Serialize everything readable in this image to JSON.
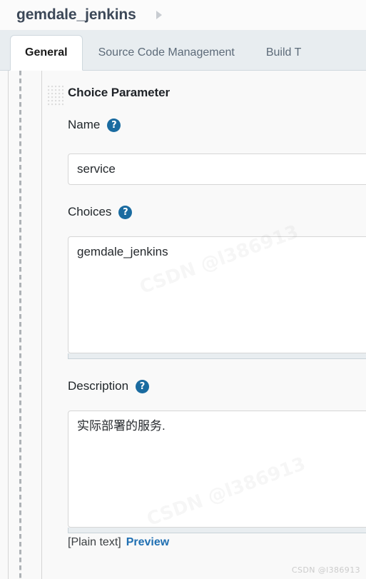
{
  "header": {
    "job_title": "gemdale_jenkins",
    "breadcrumb_caret": "▸"
  },
  "tabs": [
    {
      "label": "General",
      "active": true
    },
    {
      "label": "Source Code Management",
      "active": false
    },
    {
      "label": "Build T",
      "active": false
    }
  ],
  "parameter_block": {
    "section_title": "Choice Parameter",
    "help_glyph": "?",
    "fields": {
      "name": {
        "label": "Name",
        "value": "service",
        "placeholder": ""
      },
      "choices": {
        "label": "Choices",
        "value": "gemdale_jenkins",
        "placeholder": ""
      },
      "description": {
        "label": "Description",
        "value": "实际部署的服务.",
        "placeholder": ""
      }
    },
    "markup_footer": {
      "plain_text_label": "[Plain text]",
      "preview_label": "Preview"
    }
  },
  "watermark": {
    "corner": "CSDN @l386913",
    "diagonal": "CSDN @l386913"
  },
  "colors": {
    "accent_blue": "#1a6ba0",
    "link_blue": "#1f6fb2",
    "tab_strip_bg": "#e8edf0",
    "panel_bg": "#f9f9f9",
    "title_text": "#3c4858"
  }
}
